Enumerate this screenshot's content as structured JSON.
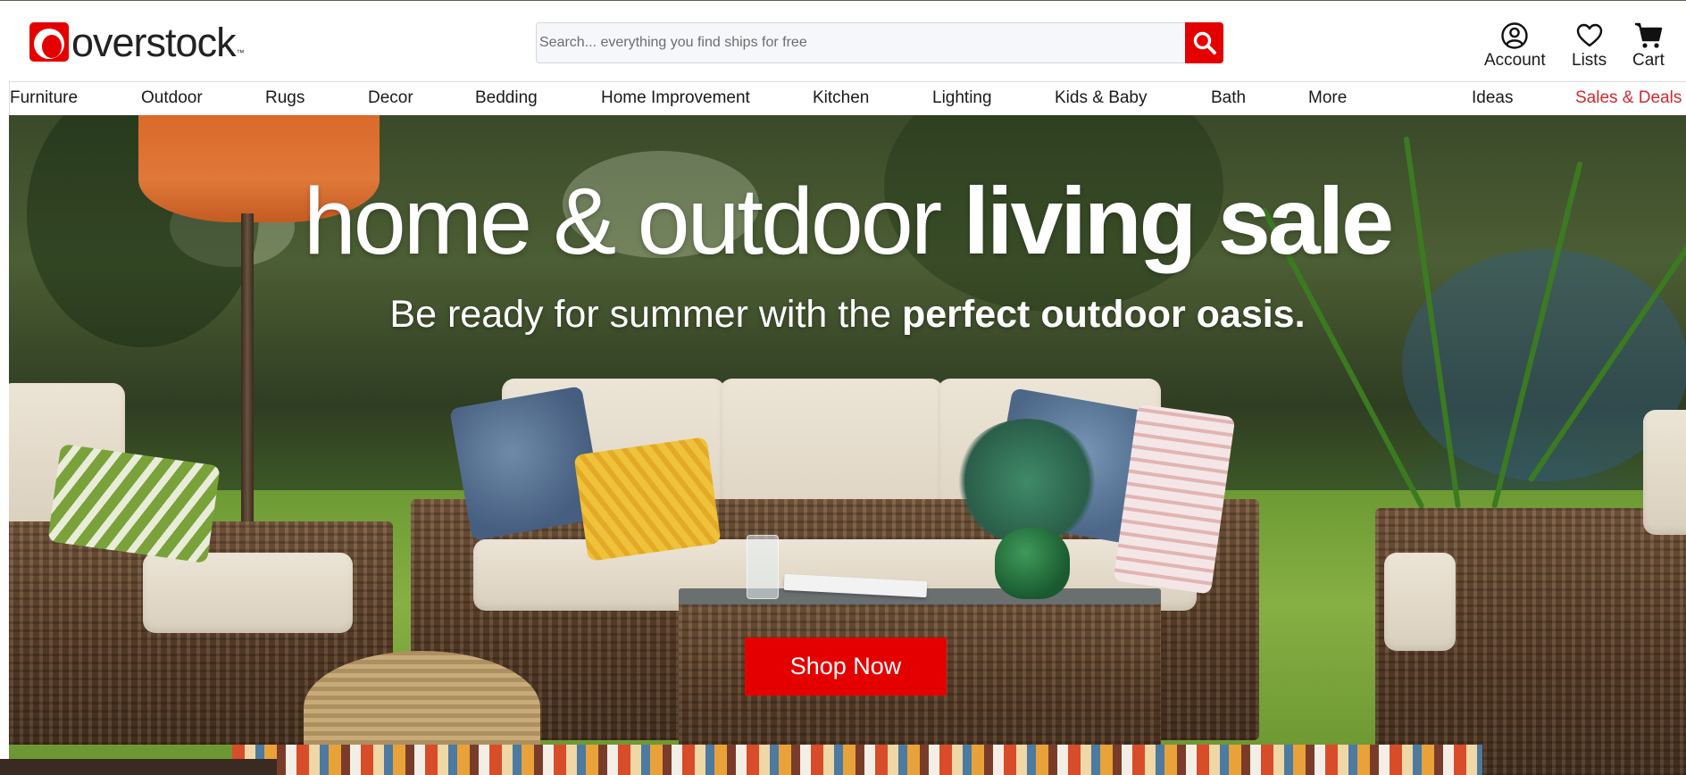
{
  "header": {
    "logo_text": "overstock",
    "logo_tm": "™",
    "search": {
      "placeholder": "Search... everything you find ships for free",
      "value": ""
    },
    "actions": {
      "account_label": "Account",
      "lists_label": "Lists",
      "cart_label": "Cart"
    }
  },
  "nav": {
    "items": [
      {
        "label": "Furniture"
      },
      {
        "label": "Outdoor"
      },
      {
        "label": "Rugs"
      },
      {
        "label": "Decor"
      },
      {
        "label": "Bedding"
      },
      {
        "label": "Home Improvement"
      },
      {
        "label": "Kitchen"
      },
      {
        "label": "Lighting"
      },
      {
        "label": "Kids & Baby"
      },
      {
        "label": "Bath"
      },
      {
        "label": "More"
      },
      {
        "label": "Ideas"
      },
      {
        "label": "Sales & Deals"
      }
    ]
  },
  "hero": {
    "title_light": "home & outdoor ",
    "title_bold": "living sale",
    "subtitle_light": "Be ready for summer with the ",
    "subtitle_bold": "perfect outdoor oasis.",
    "cta_label": "Shop Now"
  },
  "colors": {
    "brand_red": "#e50000",
    "sale_text": "#d4282f"
  }
}
